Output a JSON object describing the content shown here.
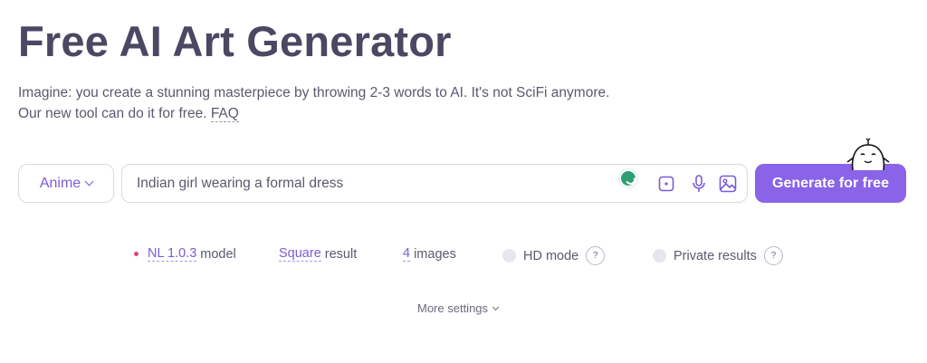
{
  "header": {
    "title": "Free AI Art Generator",
    "subtitle_line1": "Imagine: you create a stunning masterpiece by throwing 2-3 words to AI. It's not SciFi anymore.",
    "subtitle_line2": "Our new tool can do it for free.",
    "faq_label": "FAQ"
  },
  "form": {
    "style_value": "Anime",
    "prompt_value": "Indian girl wearing a formal dress",
    "generate_label": "Generate for free"
  },
  "options": {
    "model_value": "NL 1.0.3",
    "model_suffix": "model",
    "result_value": "Square",
    "result_suffix": "result",
    "images_value": "4",
    "images_suffix": "images",
    "hd_label": "HD mode",
    "private_label": "Private results",
    "help_glyph": "?"
  },
  "more_settings_label": "More settings",
  "colors": {
    "accent": "#8a63e8",
    "accent_text": "#7b5bd6",
    "model_dot": "#e0457b",
    "title": "#4a4862"
  },
  "icons": [
    "chevron-down-icon",
    "grammar-check-icon",
    "dice-icon",
    "microphone-icon",
    "image-upload-icon",
    "mascot-icon",
    "help-icon"
  ]
}
